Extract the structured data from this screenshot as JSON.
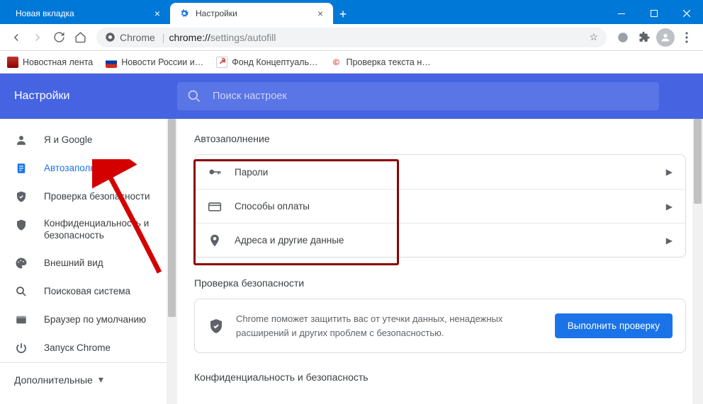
{
  "tabs": [
    {
      "label": "Новая вкладка",
      "active": false
    },
    {
      "label": "Настройки",
      "active": true
    }
  ],
  "omnibox": {
    "chrome_label": "Chrome",
    "scheme": "chrome://",
    "path": "settings/autofill"
  },
  "bookmarks": [
    {
      "label": "Новостная лента"
    },
    {
      "label": "Новости России и…"
    },
    {
      "label": "Фонд Концептуаль…"
    },
    {
      "label": "Проверка текста н…"
    }
  ],
  "app": {
    "title": "Настройки"
  },
  "search": {
    "placeholder": "Поиск настроек"
  },
  "sidebar": {
    "items": [
      {
        "label": "Я и Google"
      },
      {
        "label": "Автозаполнение"
      },
      {
        "label": "Проверка безопасности"
      },
      {
        "label": "Конфиденциальность и безопасность"
      },
      {
        "label": "Внешний вид"
      },
      {
        "label": "Поисковая система"
      },
      {
        "label": "Браузер по умолчанию"
      },
      {
        "label": "Запуск Chrome"
      }
    ],
    "advanced": "Дополнительные"
  },
  "sections": {
    "autofill_title": "Автозаполнение",
    "autofill_rows": [
      {
        "label": "Пароли"
      },
      {
        "label": "Способы оплаты"
      },
      {
        "label": "Адреса и другие данные"
      }
    ],
    "safety_title": "Проверка безопасности",
    "safety_desc": "Chrome поможет защитить вас от утечки данных, ненадежных расширений и других проблем с безопасностью.",
    "safety_button": "Выполнить проверку",
    "privacy_title": "Конфиденциальность и безопасность"
  }
}
